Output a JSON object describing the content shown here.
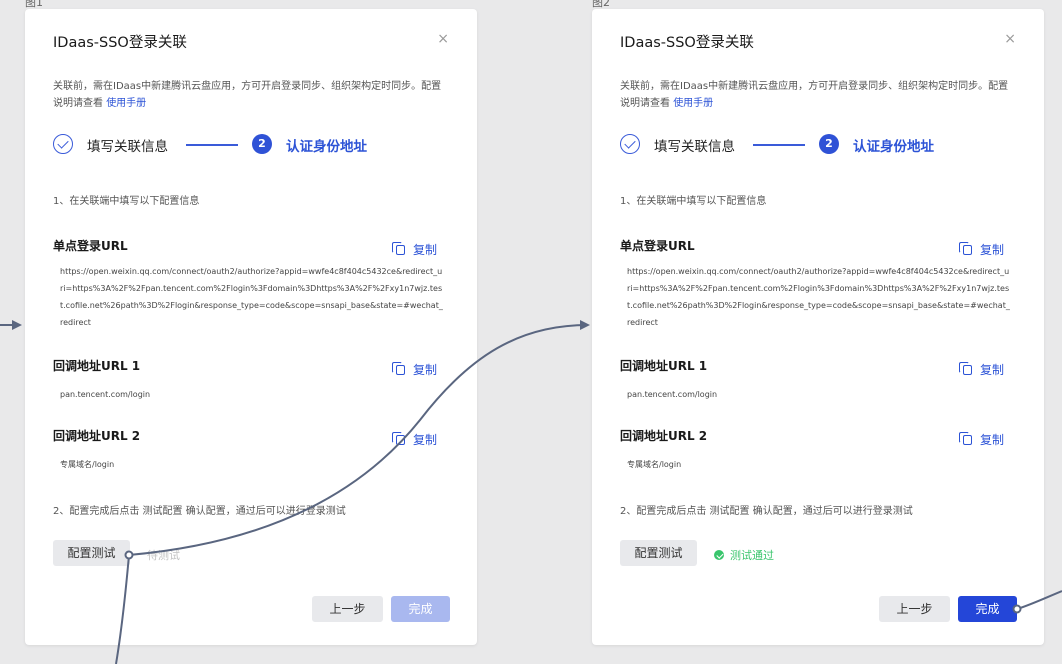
{
  "frame_labels": [
    "图1",
    "图2"
  ],
  "dialogs": [
    {
      "title": "IDaas-SSO登录关联",
      "close": "×",
      "intro": "关联前，需在IDaas中新建腾讯云盘应用，方可开启登录同步、组织架构定时同步。配置说明请查看",
      "intro_link": "使用手册",
      "step1_label": "填写关联信息",
      "step2_number": "2",
      "step2_label": "认证身份地址",
      "instruction1": "1、在关联端中填写以下配置信息",
      "sso_title": "单点登录URL",
      "sso_value": "https://open.weixin.qq.com/connect/oauth2/authorize?appid=wwfe4c8f404c5432ce&redirect_uri=https%3A%2F%2Fpan.tencent.com%2Flogin%3Fdomain%3Dhttps%3A%2F%2Fxy1n7wjz.test.cofile.net%26path%3D%2Flogin&response_type=code&scope=snsapi_base&state=#wechat_redirect",
      "callback1_title": "回调地址URL 1",
      "callback1_value": "pan.tencent.com/login",
      "callback2_title": "回调地址URL 2",
      "callback2_value": "专属域名/login",
      "copy_label": "复制",
      "instruction2": "2、配置完成后点击 测试配置 确认配置，通过后可以进行登录测试",
      "test_button": "配置测试",
      "status": "待测试",
      "status_state": "pending",
      "prev_button": "上一步",
      "done_button": "完成",
      "done_enabled": false
    },
    {
      "title": "IDaas-SSO登录关联",
      "close": "×",
      "intro": "关联前，需在IDaas中新建腾讯云盘应用，方可开启登录同步、组织架构定时同步。配置说明请查看",
      "intro_link": "使用手册",
      "step1_label": "填写关联信息",
      "step2_number": "2",
      "step2_label": "认证身份地址",
      "instruction1": "1、在关联端中填写以下配置信息",
      "sso_title": "单点登录URL",
      "sso_value": "https://open.weixin.qq.com/connect/oauth2/authorize?appid=wwfe4c8f404c5432ce&redirect_uri=https%3A%2F%2Fpan.tencent.com%2Flogin%3Fdomain%3Dhttps%3A%2F%2Fxy1n7wjz.test.cofile.net%26path%3D%2Flogin&response_type=code&scope=snsapi_base&state=#wechat_redirect",
      "callback1_title": "回调地址URL 1",
      "callback1_value": "pan.tencent.com/login",
      "callback2_title": "回调地址URL 2",
      "callback2_value": "专属域名/login",
      "copy_label": "复制",
      "instruction2": "2、配置完成后点击 测试配置 确认配置，通过后可以进行登录测试",
      "test_button": "配置测试",
      "status": "测试通过",
      "status_state": "passed",
      "prev_button": "上一步",
      "done_button": "完成",
      "done_enabled": true
    }
  ],
  "colors": {
    "accent": "#2c53d6",
    "primary_button": "#2446d8",
    "disabled_button": "#a9b8ef",
    "success": "#39c56c",
    "connector": "#5a6680"
  }
}
